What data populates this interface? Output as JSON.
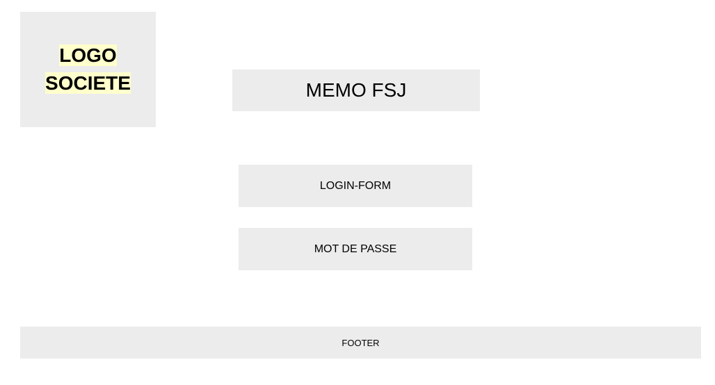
{
  "header": {
    "logo_line1": "LOGO",
    "logo_line2": "SOCIETE",
    "logo_highlight_color": "#ffffcc",
    "title": "MEMO FSJ"
  },
  "form": {
    "login_label": "LOGIN-FORM",
    "password_label": "MOT DE PASSE"
  },
  "footer": {
    "label": "FOOTER"
  },
  "colors": {
    "box_background": "#ececec",
    "page_background": "#ffffff"
  }
}
